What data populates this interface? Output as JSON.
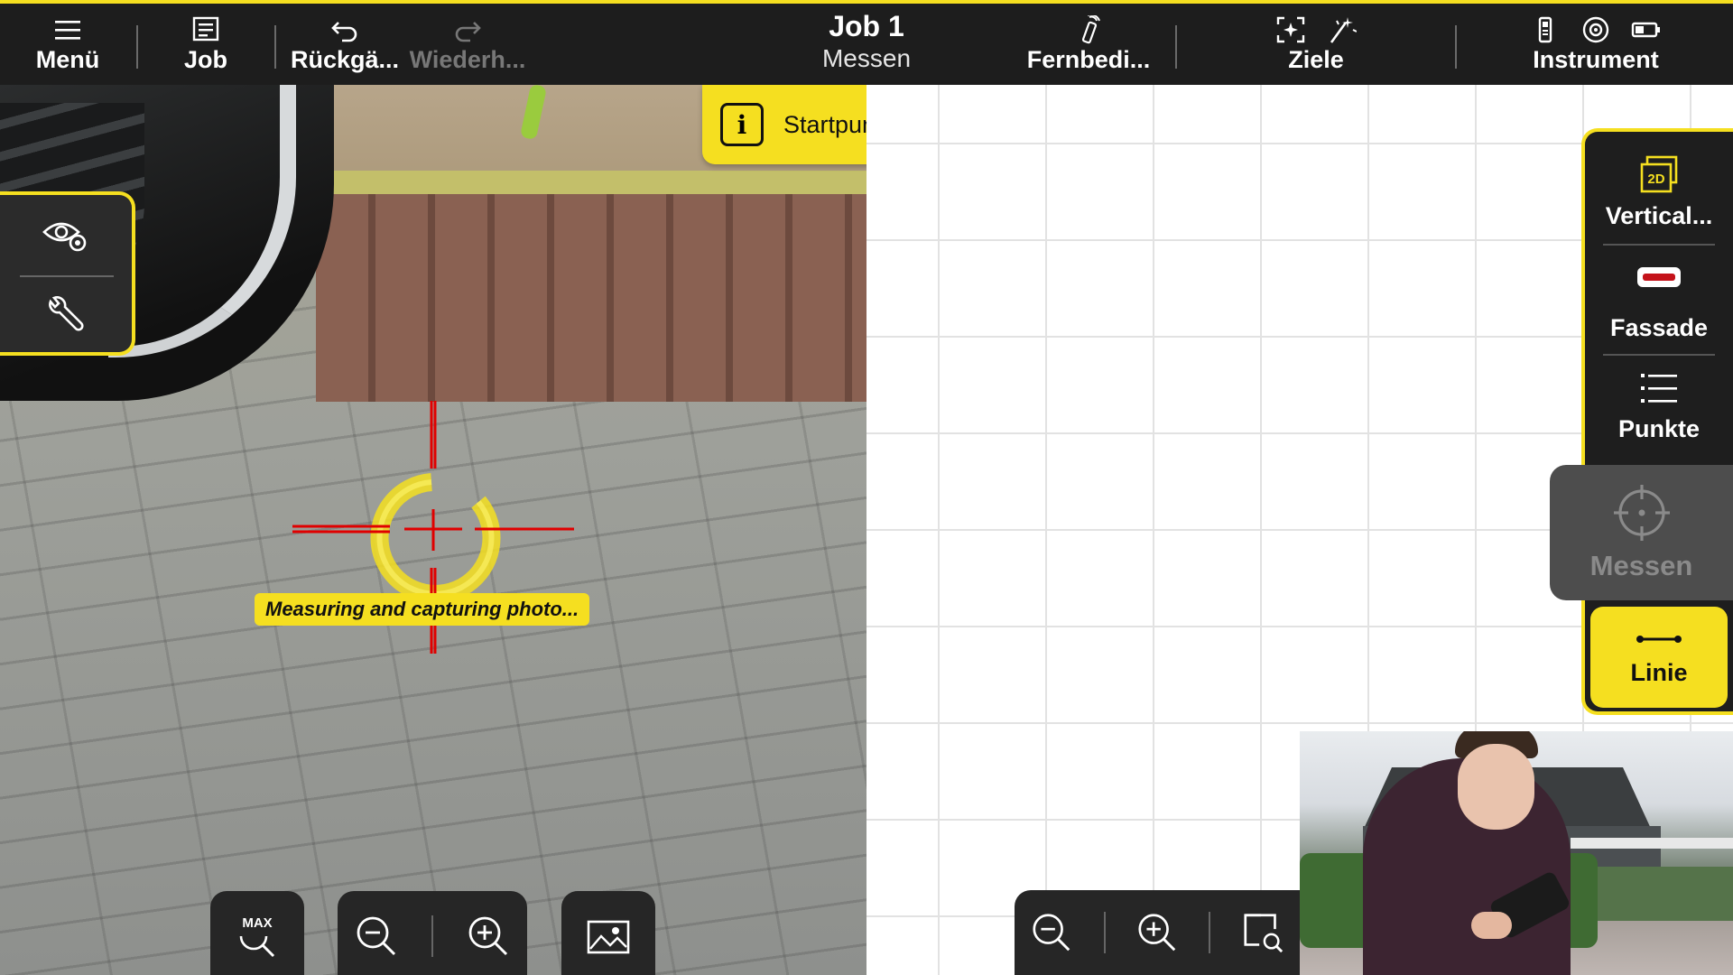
{
  "topbar": {
    "menu_label": "Menü",
    "job_label": "Job",
    "undo_label": "Rückgä...",
    "redo_label": "Wiederh...",
    "title": "Job 1",
    "subtitle": "Messen",
    "remote_label": "Fernbedi...",
    "targets_label": "Ziele",
    "instrument_label": "Instrument"
  },
  "notification": {
    "text": "Startpunkt messen."
  },
  "camera": {
    "status_text": "Measuring and capturing photo...",
    "max_label": "MAX"
  },
  "right_panel": {
    "items": [
      {
        "label": "Vertical...",
        "icon": "2d-plane-icon",
        "badge": "2D"
      },
      {
        "label": "Fassade",
        "icon": "facade-icon"
      },
      {
        "label": "Punkte",
        "icon": "list-icon"
      }
    ],
    "measure_label": "Messen",
    "line_label": "Linie"
  },
  "colors": {
    "accent": "#f5df20",
    "dark": "#1d1d1d",
    "crosshair": "#e00000",
    "facade": "#c4121a"
  }
}
